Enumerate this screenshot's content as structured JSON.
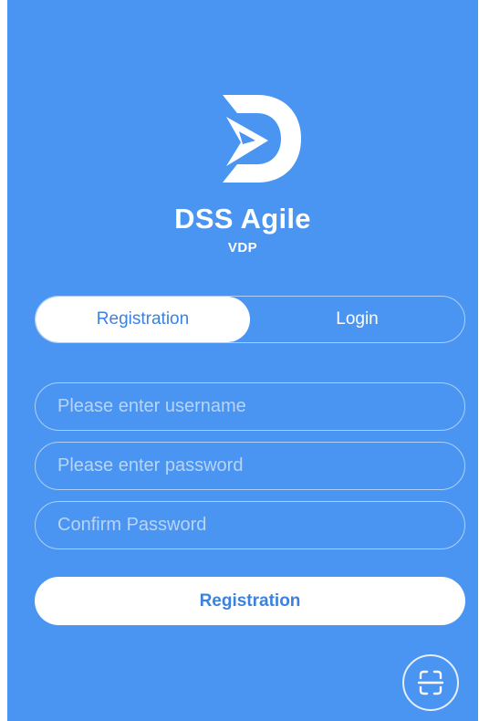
{
  "app": {
    "title": "DSS Agile",
    "subtitle": "VDP",
    "logo_icon": "dss-logo-icon"
  },
  "tabs": [
    {
      "label": "Registration",
      "active": true
    },
    {
      "label": "Login",
      "active": false
    }
  ],
  "form": {
    "username": {
      "placeholder": "Please enter username",
      "value": ""
    },
    "password": {
      "placeholder": "Please enter password",
      "value": ""
    },
    "confirm": {
      "placeholder": "Confirm Password",
      "value": ""
    }
  },
  "submit_label": "Registration",
  "scan_icon": "qr-scan-icon",
  "colors": {
    "background": "#4a95f1",
    "accent": "#3b82e0",
    "text_on_bg": "#ffffff"
  }
}
